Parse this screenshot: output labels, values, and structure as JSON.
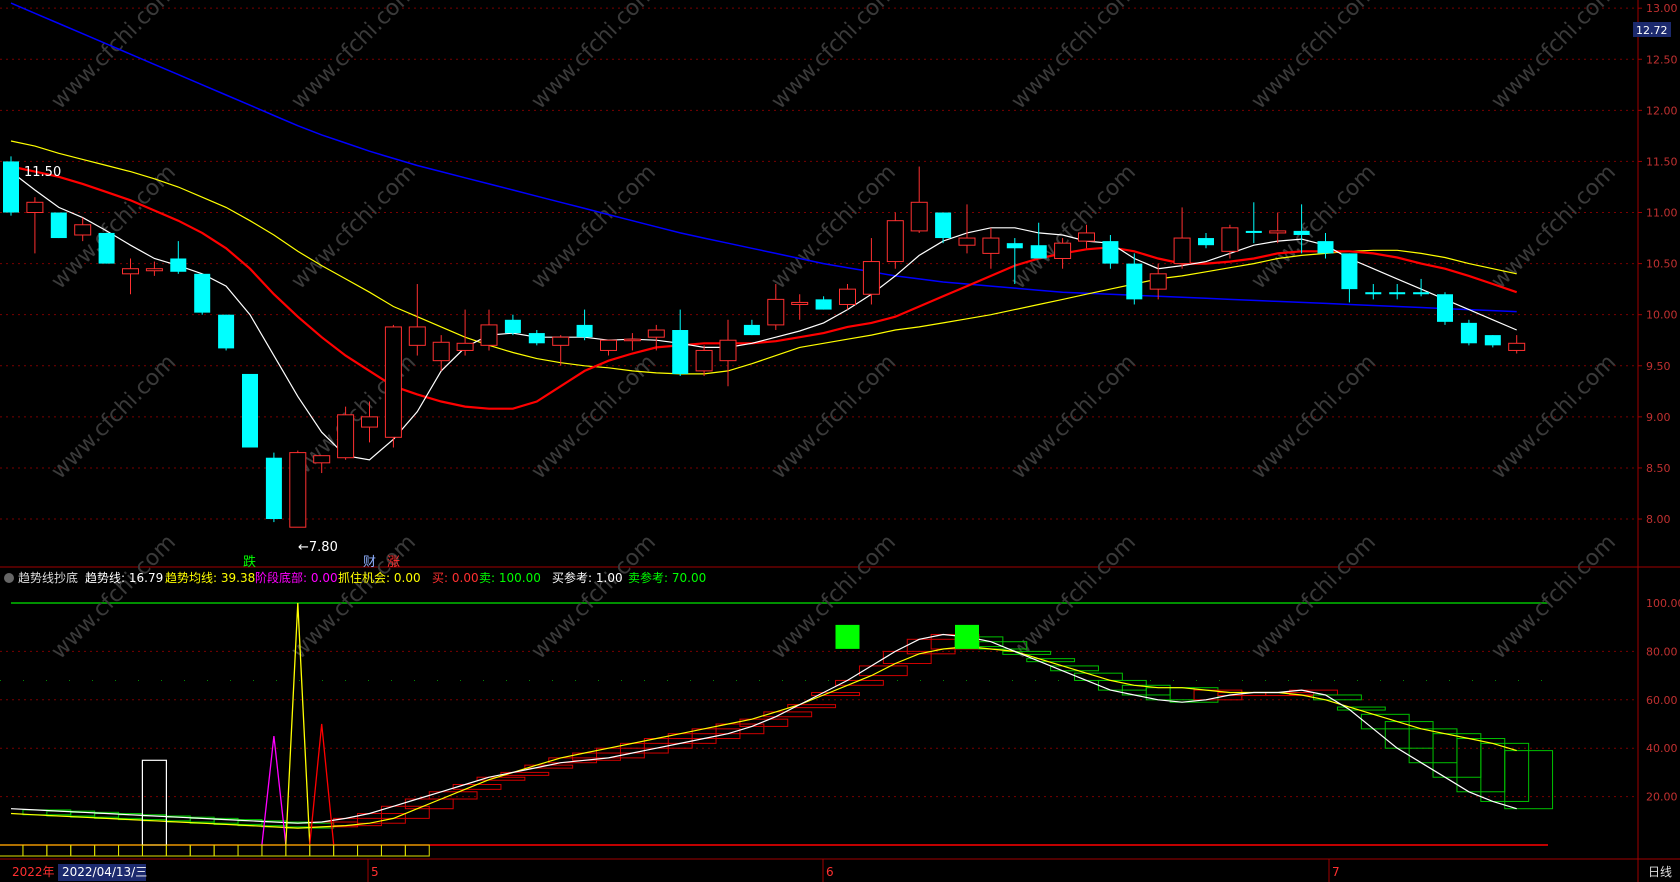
{
  "indicator_bar": {
    "name": "趋势线抄底",
    "items": [
      {
        "label": "趋势线:",
        "value": "16.79",
        "color": "#ffffff"
      },
      {
        "label": "趋势均线:",
        "value": "39.38",
        "color": "#ffff00"
      },
      {
        "label": "阶段底部:",
        "value": "0.00",
        "color": "#ff00ff"
      },
      {
        "label": "抓住机会:",
        "value": "0.00",
        "color": "#ffff00"
      },
      {
        "label": "买:",
        "value": "0.00",
        "color": "#ff3030"
      },
      {
        "label": "卖:",
        "value": "100.00",
        "color": "#00ff00"
      },
      {
        "label": "买参考:",
        "value": "1.00",
        "color": "#ffffff"
      },
      {
        "label": "卖参考:",
        "value": "70.00",
        "color": "#00ff00"
      }
    ]
  },
  "price_axis": {
    "ticks": [
      "13.00",
      "12.50",
      "12.00",
      "11.50",
      "11.00",
      "10.50",
      "10.00",
      "9.50",
      "9.00",
      "8.50",
      "8.00"
    ],
    "current": "12.72"
  },
  "indicator_axis": {
    "ticks": [
      "100.00",
      "80.00",
      "60.00",
      "40.00",
      "20.00"
    ]
  },
  "time_axis": {
    "year": "2022年",
    "cursor_date": "2022/04/13/三",
    "months": [
      "5",
      "6",
      "7"
    ],
    "period": "日线"
  },
  "annotations": {
    "high_label": "11.50",
    "low_label": "←7.80",
    "signals": [
      {
        "text": "跌",
        "color": "#00ff00"
      },
      {
        "text": "财",
        "color": "#8fb0ff"
      },
      {
        "text": "涨",
        "color": "#ff3030"
      }
    ]
  },
  "watermark": "www.cfchi.com",
  "colors": {
    "up": "#ff3030",
    "down": "#00ffff",
    "ma5": "#ffffff",
    "ma10": "#ff0000",
    "ma20": "#ffff00",
    "ma60": "#0000ff"
  },
  "chart_data": {
    "type": "candlestick",
    "price_range": [
      7.55,
      13.08
    ],
    "candles": [
      {
        "o": 11.5,
        "h": 11.55,
        "l": 10.97,
        "c": 11.0
      },
      {
        "o": 11.0,
        "h": 11.15,
        "l": 10.6,
        "c": 11.1
      },
      {
        "o": 11.0,
        "h": 11.0,
        "l": 10.75,
        "c": 10.75
      },
      {
        "o": 10.78,
        "h": 10.95,
        "l": 10.72,
        "c": 10.88
      },
      {
        "o": 10.8,
        "h": 10.8,
        "l": 10.5,
        "c": 10.5
      },
      {
        "o": 10.4,
        "h": 10.55,
        "l": 10.2,
        "c": 10.45
      },
      {
        "o": 10.43,
        "h": 10.52,
        "l": 10.38,
        "c": 10.45
      },
      {
        "o": 10.55,
        "h": 10.72,
        "l": 10.4,
        "c": 10.42
      },
      {
        "o": 10.4,
        "h": 10.4,
        "l": 10.0,
        "c": 10.02
      },
      {
        "o": 10.0,
        "h": 10.0,
        "l": 9.65,
        "c": 9.67
      },
      {
        "o": 9.42,
        "h": 9.42,
        "l": 8.7,
        "c": 8.7
      },
      {
        "o": 8.6,
        "h": 8.65,
        "l": 7.97,
        "c": 8.0
      },
      {
        "o": 7.92,
        "h": 8.67,
        "l": 7.92,
        "c": 8.65
      },
      {
        "o": 8.55,
        "h": 8.62,
        "l": 8.45,
        "c": 8.62
      },
      {
        "o": 8.6,
        "h": 9.1,
        "l": 8.58,
        "c": 9.02
      },
      {
        "o": 8.9,
        "h": 9.15,
        "l": 8.75,
        "c": 9.0
      },
      {
        "o": 8.8,
        "h": 9.9,
        "l": 8.7,
        "c": 9.88
      },
      {
        "o": 9.7,
        "h": 10.3,
        "l": 9.6,
        "c": 9.88
      },
      {
        "o": 9.55,
        "h": 9.8,
        "l": 9.45,
        "c": 9.73
      },
      {
        "o": 9.65,
        "h": 10.05,
        "l": 9.6,
        "c": 9.72
      },
      {
        "o": 9.7,
        "h": 10.05,
        "l": 9.65,
        "c": 9.9
      },
      {
        "o": 9.95,
        "h": 10.0,
        "l": 9.8,
        "c": 9.82
      },
      {
        "o": 9.82,
        "h": 9.85,
        "l": 9.7,
        "c": 9.72
      },
      {
        "o": 9.7,
        "h": 9.8,
        "l": 9.5,
        "c": 9.78
      },
      {
        "o": 9.9,
        "h": 10.05,
        "l": 9.75,
        "c": 9.78
      },
      {
        "o": 9.65,
        "h": 9.75,
        "l": 9.6,
        "c": 9.75
      },
      {
        "o": 9.75,
        "h": 9.82,
        "l": 9.65,
        "c": 9.76
      },
      {
        "o": 9.78,
        "h": 9.9,
        "l": 9.65,
        "c": 9.85
      },
      {
        "o": 9.85,
        "h": 10.05,
        "l": 9.4,
        "c": 9.42
      },
      {
        "o": 9.45,
        "h": 9.7,
        "l": 9.4,
        "c": 9.65
      },
      {
        "o": 9.55,
        "h": 9.95,
        "l": 9.3,
        "c": 9.75
      },
      {
        "o": 9.9,
        "h": 9.95,
        "l": 9.8,
        "c": 9.8
      },
      {
        "o": 9.9,
        "h": 10.3,
        "l": 9.85,
        "c": 10.15
      },
      {
        "o": 10.1,
        "h": 10.2,
        "l": 9.95,
        "c": 10.12
      },
      {
        "o": 10.15,
        "h": 10.18,
        "l": 10.05,
        "c": 10.05
      },
      {
        "o": 10.1,
        "h": 10.3,
        "l": 10.05,
        "c": 10.25
      },
      {
        "o": 10.2,
        "h": 10.75,
        "l": 10.1,
        "c": 10.52
      },
      {
        "o": 10.52,
        "h": 11.0,
        "l": 10.45,
        "c": 10.92
      },
      {
        "o": 10.82,
        "h": 11.45,
        "l": 10.8,
        "c": 11.1
      },
      {
        "o": 11.0,
        "h": 11.0,
        "l": 10.7,
        "c": 10.75
      },
      {
        "o": 10.68,
        "h": 11.08,
        "l": 10.6,
        "c": 10.75
      },
      {
        "o": 10.6,
        "h": 10.85,
        "l": 10.45,
        "c": 10.75
      },
      {
        "o": 10.7,
        "h": 10.75,
        "l": 10.3,
        "c": 10.65
      },
      {
        "o": 10.68,
        "h": 10.9,
        "l": 10.55,
        "c": 10.55
      },
      {
        "o": 10.55,
        "h": 10.75,
        "l": 10.45,
        "c": 10.7
      },
      {
        "o": 10.72,
        "h": 10.88,
        "l": 10.65,
        "c": 10.8
      },
      {
        "o": 10.72,
        "h": 10.78,
        "l": 10.45,
        "c": 10.5
      },
      {
        "o": 10.5,
        "h": 10.6,
        "l": 10.1,
        "c": 10.15
      },
      {
        "o": 10.25,
        "h": 10.5,
        "l": 10.15,
        "c": 10.4
      },
      {
        "o": 10.5,
        "h": 11.05,
        "l": 10.45,
        "c": 10.75
      },
      {
        "o": 10.75,
        "h": 10.8,
        "l": 10.65,
        "c": 10.68
      },
      {
        "o": 10.62,
        "h": 10.88,
        "l": 10.55,
        "c": 10.85
      },
      {
        "o": 10.82,
        "h": 11.1,
        "l": 10.7,
        "c": 10.8
      },
      {
        "o": 10.8,
        "h": 11.0,
        "l": 10.7,
        "c": 10.82
      },
      {
        "o": 10.82,
        "h": 11.08,
        "l": 10.6,
        "c": 10.78
      },
      {
        "o": 10.72,
        "h": 10.8,
        "l": 10.55,
        "c": 10.6
      },
      {
        "o": 10.6,
        "h": 10.6,
        "l": 10.12,
        "c": 10.25
      },
      {
        "o": 10.22,
        "h": 10.3,
        "l": 10.15,
        "c": 10.2
      },
      {
        "o": 10.22,
        "h": 10.3,
        "l": 10.15,
        "c": 10.2
      },
      {
        "o": 10.22,
        "h": 10.35,
        "l": 10.18,
        "c": 10.2
      },
      {
        "o": 10.2,
        "h": 10.22,
        "l": 9.9,
        "c": 9.93
      },
      {
        "o": 9.92,
        "h": 9.95,
        "l": 9.7,
        "c": 9.72
      },
      {
        "o": 9.8,
        "h": 9.8,
        "l": 9.68,
        "c": 9.7
      },
      {
        "o": 9.65,
        "h": 9.8,
        "l": 9.62,
        "c": 9.72
      }
    ],
    "ma5": [
      11.4,
      11.22,
      11.05,
      10.95,
      10.82,
      10.68,
      10.55,
      10.48,
      10.4,
      10.28,
      10.0,
      9.6,
      9.2,
      8.85,
      8.62,
      8.58,
      8.78,
      9.05,
      9.45,
      9.68,
      9.8,
      9.82,
      9.78,
      9.78,
      9.78,
      9.75,
      9.76,
      9.75,
      9.72,
      9.68,
      9.68,
      9.72,
      9.78,
      9.84,
      9.92,
      10.05,
      10.2,
      10.38,
      10.58,
      10.72,
      10.8,
      10.85,
      10.85,
      10.8,
      10.78,
      10.72,
      10.7,
      10.55,
      10.45,
      10.48,
      10.52,
      10.6,
      10.68,
      10.72,
      10.74,
      10.68,
      10.55,
      10.45,
      10.35,
      10.25,
      10.15,
      10.05,
      9.95,
      9.85
    ],
    "ma10": [
      11.45,
      11.4,
      11.35,
      11.28,
      11.2,
      11.12,
      11.02,
      10.92,
      10.8,
      10.65,
      10.45,
      10.2,
      9.98,
      9.78,
      9.6,
      9.45,
      9.3,
      9.22,
      9.15,
      9.1,
      9.08,
      9.08,
      9.15,
      9.3,
      9.45,
      9.55,
      9.62,
      9.68,
      9.7,
      9.72,
      9.72,
      9.72,
      9.74,
      9.78,
      9.82,
      9.88,
      9.92,
      9.98,
      10.08,
      10.18,
      10.28,
      10.38,
      10.48,
      10.55,
      10.6,
      10.64,
      10.66,
      10.62,
      10.55,
      10.5,
      10.5,
      10.52,
      10.55,
      10.6,
      10.62,
      10.62,
      10.62,
      10.6,
      10.56,
      10.5,
      10.45,
      10.38,
      10.3,
      10.22
    ],
    "ma20": [
      11.7,
      11.65,
      11.58,
      11.52,
      11.46,
      11.4,
      11.33,
      11.25,
      11.15,
      11.05,
      10.92,
      10.78,
      10.62,
      10.48,
      10.35,
      10.22,
      10.08,
      9.98,
      9.88,
      9.78,
      9.7,
      9.63,
      9.57,
      9.53,
      9.5,
      9.48,
      9.45,
      9.43,
      9.42,
      9.42,
      9.45,
      9.52,
      9.6,
      9.68,
      9.72,
      9.76,
      9.8,
      9.85,
      9.88,
      9.92,
      9.96,
      10.0,
      10.05,
      10.1,
      10.15,
      10.2,
      10.25,
      10.3,
      10.35,
      10.38,
      10.42,
      10.46,
      10.5,
      10.55,
      10.58,
      10.6,
      10.62,
      10.63,
      10.63,
      10.6,
      10.56,
      10.5,
      10.45,
      10.4
    ],
    "ma60": [
      13.05,
      12.95,
      12.85,
      12.75,
      12.65,
      12.55,
      12.45,
      12.35,
      12.25,
      12.15,
      12.05,
      11.95,
      11.85,
      11.76,
      11.68,
      11.6,
      11.53,
      11.46,
      11.4,
      11.34,
      11.28,
      11.22,
      11.16,
      11.1,
      11.04,
      10.98,
      10.92,
      10.86,
      10.8,
      10.75,
      10.7,
      10.65,
      10.6,
      10.55,
      10.5,
      10.46,
      10.42,
      10.38,
      10.35,
      10.32,
      10.3,
      10.28,
      10.26,
      10.24,
      10.22,
      10.21,
      10.2,
      10.19,
      10.18,
      10.17,
      10.16,
      10.15,
      10.14,
      10.13,
      10.12,
      10.11,
      10.1,
      10.09,
      10.08,
      10.07,
      10.06,
      10.05,
      10.04,
      10.03
    ],
    "indicator": {
      "range": [
        0,
        100
      ],
      "trend_line": [
        15,
        14.5,
        14,
        13.5,
        13,
        12.5,
        12,
        11.5,
        11,
        10.5,
        10,
        9.5,
        9,
        9.5,
        11,
        13,
        16,
        19,
        22,
        25,
        28,
        30,
        32,
        34,
        35,
        36,
        38,
        40,
        42,
        44,
        46,
        49,
        53,
        58,
        63,
        68,
        74,
        80,
        85,
        87,
        86,
        84,
        80,
        76,
        72,
        68,
        64,
        62,
        60,
        59,
        60,
        62,
        63,
        63,
        64,
        62,
        56,
        48,
        40,
        34,
        28,
        22,
        18,
        15
      ],
      "trend_avg": [
        13,
        12.5,
        12,
        11.5,
        11,
        10.5,
        10,
        9.5,
        9,
        8.5,
        8,
        7.5,
        7,
        7.5,
        8,
        9,
        11,
        15,
        19,
        23,
        27,
        30,
        33,
        36,
        38,
        40,
        42,
        44,
        46,
        48,
        50,
        52,
        55,
        58,
        62,
        66,
        70,
        75,
        79,
        81,
        82,
        81,
        80,
        77,
        74,
        71,
        68,
        66,
        65,
        65,
        64,
        63,
        63,
        63,
        62,
        60,
        57,
        54,
        51,
        48,
        46,
        44,
        42,
        39
      ]
    }
  }
}
